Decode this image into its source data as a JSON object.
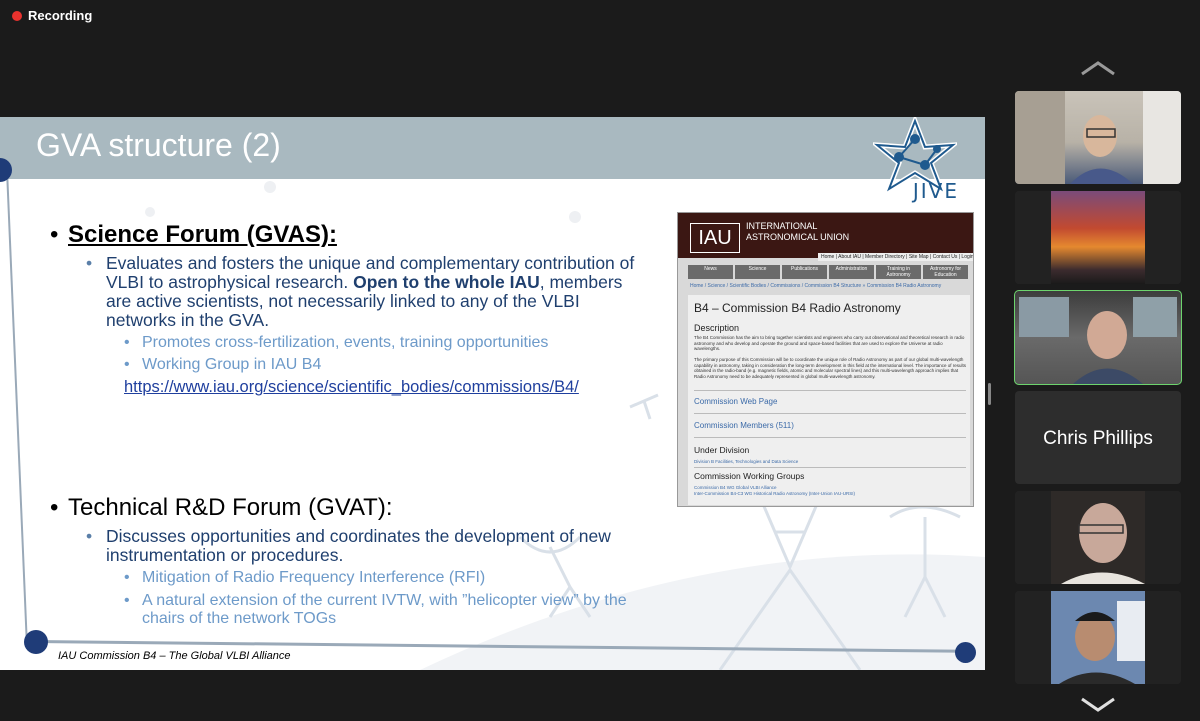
{
  "recording": {
    "label": "Recording"
  },
  "slide": {
    "title": "GVA structure (2)",
    "logo_text": "JIVE",
    "footer": "IAU Commission B4 – The Global VLBI Alliance",
    "section1": {
      "heading": "Science Forum (GVAS):",
      "sub1_part1": "Evaluates and fosters the unique and complementary contribution of VLBI to astrophysical research.",
      "sub1_bold": "Open to the whole IAU",
      "sub1_part2": ", members are active scientists, not necessarily linked to any of the VLBI networks in the GVA.",
      "items": [
        "Promotes cross-fertilization, events, training opportunities",
        "Working Group in IAU B4"
      ],
      "link": "https://www.iau.org/science/scientific_bodies/commissions/B4/"
    },
    "section2": {
      "heading": "Technical R&D Forum (GVAT):",
      "sub1": "Discusses opportunities and coordinates the development of new instrumentation or procedures.",
      "items": [
        "Mitigation of Radio Frequency Interference (RFI)",
        "A natural extension of the current IVTW, with ”helicopter view” by the chairs of the network TOGs"
      ]
    },
    "iau_page": {
      "org_mark": "IAU",
      "org_name": "INTERNATIONAL ASTRONOMICAL UNION",
      "top_links": "Home | About IAU | Member Directory | Site Map | Contact Us | Login",
      "nav": [
        "News",
        "Science",
        "Publications",
        "Administration",
        "Training in Astronomy",
        "Astronomy for Education"
      ],
      "breadcrumb": "Home / Science / Scientific Bodies / Commissions / Commission B4 Structure » Commission B4 Radio Astronomy",
      "heading": "B4 – Commission B4 Radio Astronomy",
      "description_label": "Description",
      "para1": "The B4 Commission has the aim to bring together scientists and engineers who carry out observational and theoretical research in radio astronomy and who develop and operate the ground and space-based facilities that are used to explore the Universe at radio wavelengths.",
      "para2": "The primary purpose of this Commission will be to coordinate the unique role of Radio Astronomy as part of our global multi-wavelength capability in astronomy, taking in consideration the long-term development in this field at the international level. The importance of results obtained in the radio-band (e.g. magnetic fields, atomic and molecular spectral lines) and this multi-wavelength approach implies that Radio Astronomy need to be adequately represented in global multi-wavelength astronomy.",
      "web_page_link": "Commission Web Page",
      "members_link": "Commission Members (511)",
      "division_label": "Under Division",
      "division_value": "Division B Facilities, Technologies and Data Science",
      "wg_label": "Commission Working Groups",
      "wg1": "Commission B4 WG Global VLBI Alliance",
      "wg2": "Inter-Commission B4-C3 WG Historical Radio Astronomy (Inter-Union IAU-URSI)"
    }
  },
  "participants": [
    {
      "type": "video",
      "id": "p1"
    },
    {
      "type": "video",
      "id": "p2"
    },
    {
      "type": "video",
      "id": "p3",
      "active": true
    },
    {
      "type": "name",
      "name": "Chris Phillips"
    },
    {
      "type": "video",
      "id": "p5"
    },
    {
      "type": "video",
      "id": "p6"
    }
  ],
  "colors": {
    "accent_active": "#6dd46d",
    "recording": "#e8322e",
    "slide_header": "#a9b9c0"
  }
}
